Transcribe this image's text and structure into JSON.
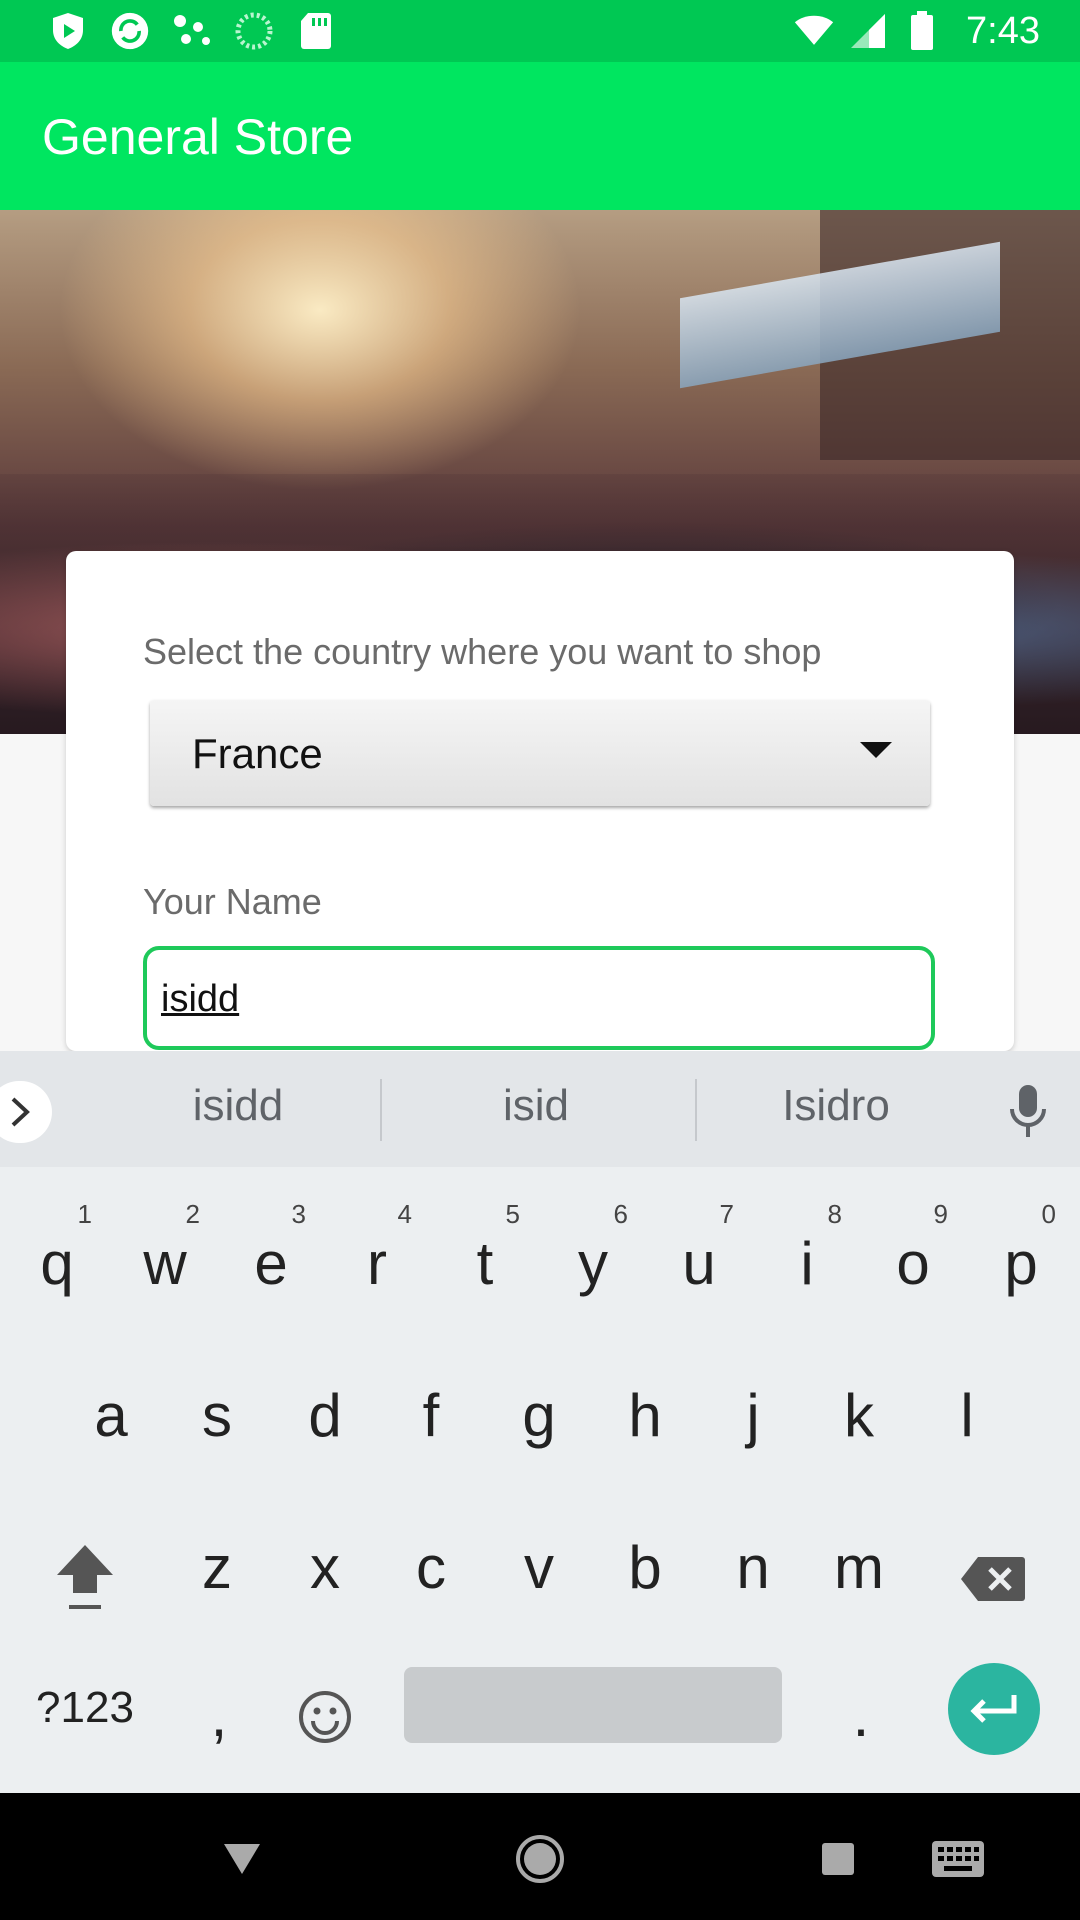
{
  "status_bar": {
    "time": "7:43",
    "left_icons": [
      "play-protect-icon",
      "sync-icon",
      "dots-icon",
      "loading-icon",
      "sd-card-icon"
    ],
    "right_icons": [
      "wifi-icon",
      "signal-icon",
      "battery-icon"
    ]
  },
  "app_bar": {
    "title": "General Store",
    "color": "#00e660"
  },
  "form": {
    "country_label": "Select the country where you want to shop",
    "country_value": "France",
    "name_label": "Your Name",
    "name_value": "isidd",
    "accent": "#1ec95a"
  },
  "keyboard": {
    "suggestions": [
      "isidd",
      "isid",
      "Isidro"
    ],
    "row1": [
      {
        "key": "q",
        "hint": "1"
      },
      {
        "key": "w",
        "hint": "2"
      },
      {
        "key": "e",
        "hint": "3"
      },
      {
        "key": "r",
        "hint": "4"
      },
      {
        "key": "t",
        "hint": "5"
      },
      {
        "key": "y",
        "hint": "6"
      },
      {
        "key": "u",
        "hint": "7"
      },
      {
        "key": "i",
        "hint": "8"
      },
      {
        "key": "o",
        "hint": "9"
      },
      {
        "key": "p",
        "hint": "0"
      }
    ],
    "row2": [
      "a",
      "s",
      "d",
      "f",
      "g",
      "h",
      "j",
      "k",
      "l"
    ],
    "row3": [
      "z",
      "x",
      "c",
      "v",
      "b",
      "n",
      "m"
    ],
    "symbols_label": "?123",
    "comma_label": ",",
    "period_label": ".",
    "enter_color": "#2bb5a0"
  },
  "nav_bar": {
    "icons": [
      "back-icon",
      "home-icon",
      "recents-icon",
      "keyboard-icon"
    ]
  }
}
